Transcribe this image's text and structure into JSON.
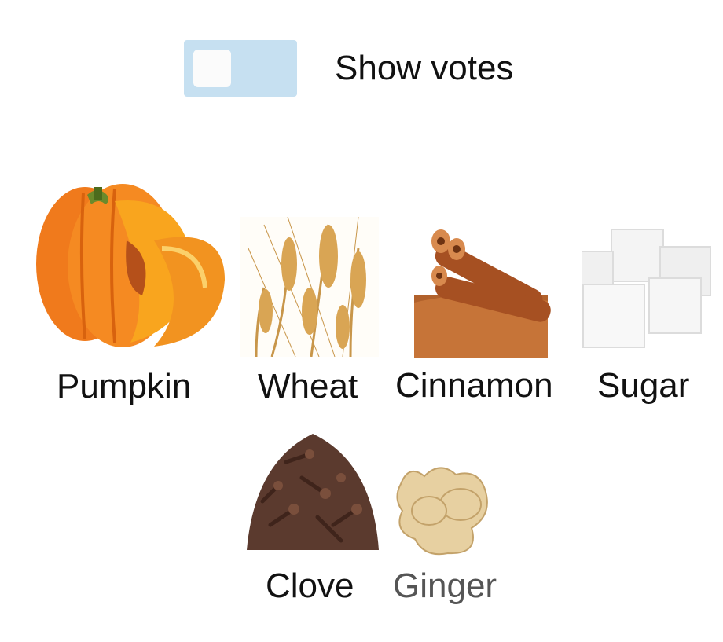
{
  "toggle": {
    "label": "Show votes",
    "checked": false
  },
  "items": [
    {
      "label": "Pumpkin",
      "icon": "pumpkin-image"
    },
    {
      "label": "Wheat",
      "icon": "wheat-image"
    },
    {
      "label": "Cinnamon",
      "icon": "cinnamon-image"
    },
    {
      "label": "Sugar",
      "icon": "sugar-image"
    },
    {
      "label": "Clove",
      "icon": "clove-image"
    },
    {
      "label": "Ginger",
      "icon": "ginger-image"
    }
  ]
}
